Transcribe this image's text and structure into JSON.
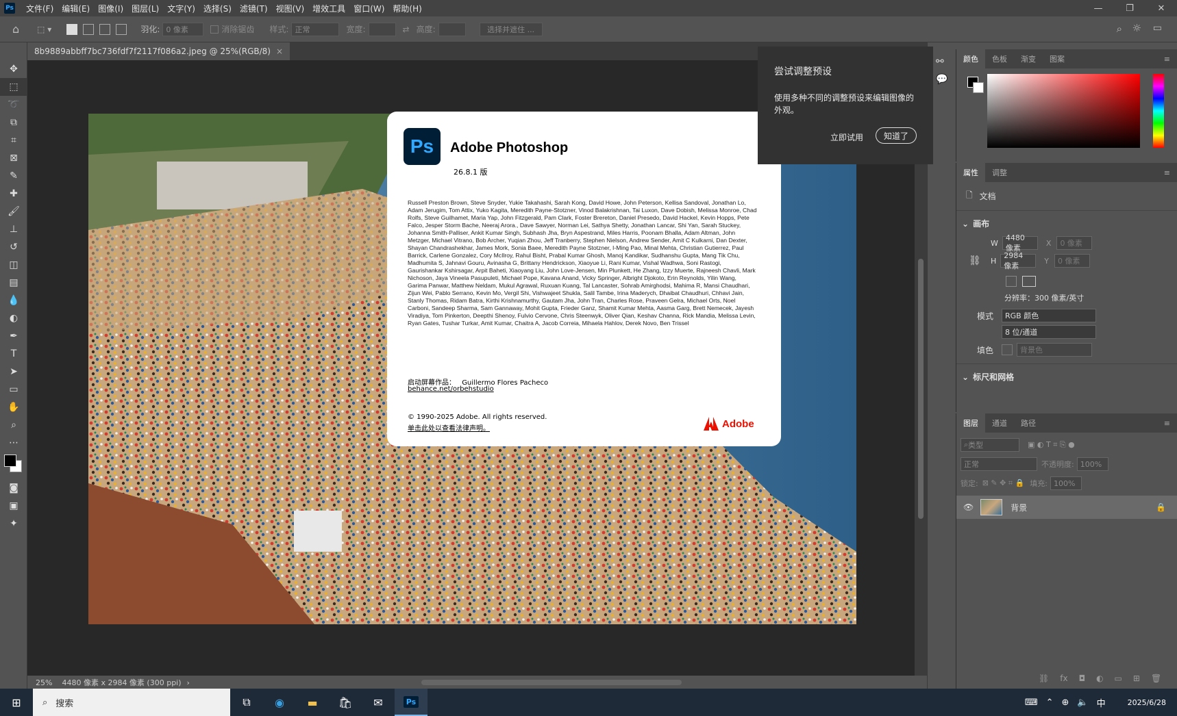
{
  "menubar": {
    "app_icon": "Ps",
    "items": [
      "文件(F)",
      "编辑(E)",
      "图像(I)",
      "图层(L)",
      "文字(Y)",
      "选择(S)",
      "滤镜(T)",
      "视图(V)",
      "增效工具",
      "窗口(W)",
      "帮助(H)"
    ]
  },
  "options": {
    "feather_label": "羽化:",
    "feather_value": "0 像素",
    "antialias_label": "消除锯齿",
    "style_label": "样式:",
    "style_value": "正常",
    "width_label": "宽度:",
    "height_label": "高度:",
    "select_mask": "选择并遮住 ..."
  },
  "document_tab": {
    "title": "8b9889abbff7bc736fdf7f2117f086a2.jpeg @ 25%(RGB/8)",
    "close": "×"
  },
  "status": {
    "zoom": "25%",
    "info": "4480 像素 x 2984 像素 (300 ppi)",
    "arrow": "›"
  },
  "about": {
    "logo": "Ps",
    "title": "Adobe Photoshop",
    "version": "26.8.1 版",
    "credits": "Russell Preston Brown, Steve Snyder, Yukie Takahashi, Sarah Kong, David Howe, John Peterson, Kellisa Sandoval, Jonathan Lo, Adam Jerugim, Tom Attix, Yuko Kagita, Meredith Payne-Stotzner, Vinod Balakrishnan, Tai Luxon, Dave Dobish, Melissa Monroe, Chad Rolfs, Steve Guilhamet, Maria Yap, John Fitzgerald, Pam Clark, Foster Brereton, Daniel Presedo, David Hackel, Kevin Hopps, Pete Falco, Jesper Storm Bache, Neeraj Arora., Dave Sawyer, Norman Lei, Sathya Shetty, Jonathan Lancar, Shi Yan, Sarah Stuckey, Johanna Smith-Palliser, Ankit Kumar Singh, Subhash Jha, Bryn Aspestrand, Miles Harris, Poonam Bhalla, Adam Altman, John Metzger, Michael Vitrano, Bob Archer, Yuqian Zhou, Jeff Tranberry, Stephen Nielson, Andrew Sender, Amit C Kulkarni, Dan Dexter, Shayan Chandrashekhar, James Mork, Sonia Baee, Meredith Payne Stotzner, I-Ming Pao, Minal Mehta, Christian Gutierrez, Paul Barrick, Carlene Gonzalez, Cory McIlroy, Rahul Bisht, Prabal Kumar Ghosh, Manoj Kandikar, Sudhanshu Gupta, Mang Tik Chu, Madhumita S, Jahnavi Gouru, Avinasha G, Brittany Hendrickson, Xiaoyue Li, Rani Kumar, Vishal Wadhwa, Soni Rastogi, Gaurishankar Kshirsagar, Arpit Baheti, Xiaoyang Liu, John Love-Jensen, Min Plunkett, He Zhang, Izzy Muerte, Rajneesh Chavli, Mark Nichoson, Jaya Vineela Pasupuleti, Michael Pope, Kavana Anand, Vicky Springer, Albright Djokoto, Erin Reynolds, Yilin Wang, Garima Panwar, Matthew Neldam, Mukul Agrawal, Ruxuan Kuang, Tal Lancaster, Sohrab Amirghodsi, Mahima R, Mansi Chaudhari, Zijun Wei, Pablo Serrano, Kevin Mo, Vergil Shi, Vishwajeet Shukla, Salil Tambe, Irina Maderych, Dhaibat Chaudhuri, Chhavi Jain, Stanly Thomas, Ridam Batra, Kirthi Krishnamurthy, Gautam Jha, John Tran, Charles Rose, Praveen Gelra, Michael Orts, Noel Carboni, Sandeep Sharma, Sam Gannaway, Mohit Gupta, Frieder Ganz, Shamit Kumar Mehta, Aasma Garg, Brett Nemecek, Jayesh Viradiya, Tom Pinkerton, Deepthi Shenoy, Fulvio Cervone, Chris Steenwyk, Oliver Qian, Keshav Channa, Rick Mandia, Melissa Levin, Ryan Gates, Tushar Turkar, Amit Kumar, Chaitra A, Jacob Correia, Mihaela Hahlov, Derek Novo, Ben Trissel",
    "splash_label": "启动屏幕作品：",
    "splash_author": "Guillermo Flores Pacheco",
    "splash_link": "behance.net/orbehstudio",
    "copyright": "© 1990-2025 Adobe. All rights reserved.",
    "legal_link": "单击此处以查看法律声明。",
    "adobe": "Adobe"
  },
  "tip": {
    "title": "尝试调整预设",
    "body": "使用多种不同的调整预设来编辑图像的外观。",
    "try_btn": "立即试用",
    "ok_btn": "知道了"
  },
  "color_panel": {
    "tabs": [
      "颜色",
      "色板",
      "渐变",
      "图案"
    ]
  },
  "props_panel": {
    "tabs": [
      "属性",
      "调整"
    ],
    "doc_label": "文档",
    "canvas_section": "画布",
    "w_label": "W",
    "w_value": "4480 像素",
    "h_label": "H",
    "h_value": "2984 像素",
    "x_label": "X",
    "x_value": "0 像素",
    "y_label": "Y",
    "y_value": "0 像素",
    "resolution": "分辨率：300 像素/英寸",
    "mode_label": "模式",
    "mode_value": "RGB 颜色",
    "depth_value": "8 位/通道",
    "fill_label": "填色",
    "fill_value": "背景色",
    "rulers_section": "标尺和网格"
  },
  "layers_panel": {
    "tabs": [
      "图层",
      "通道",
      "路径"
    ],
    "kind_filter": "类型",
    "blend_mode": "正常",
    "opacity_label": "不透明度:",
    "opacity_value": "100%",
    "lock_label": "锁定:",
    "fill_label": "填充:",
    "fill_value": "100%",
    "layer_name": "背景"
  },
  "taskbar": {
    "search_placeholder": "搜索",
    "ime": "中",
    "date": "2025/6/28"
  },
  "colors": {
    "ps_blue": "#31a8ff",
    "ps_dark": "#001e36",
    "adobe_red": "#eb1000",
    "taskbar": "#1f2a38"
  }
}
